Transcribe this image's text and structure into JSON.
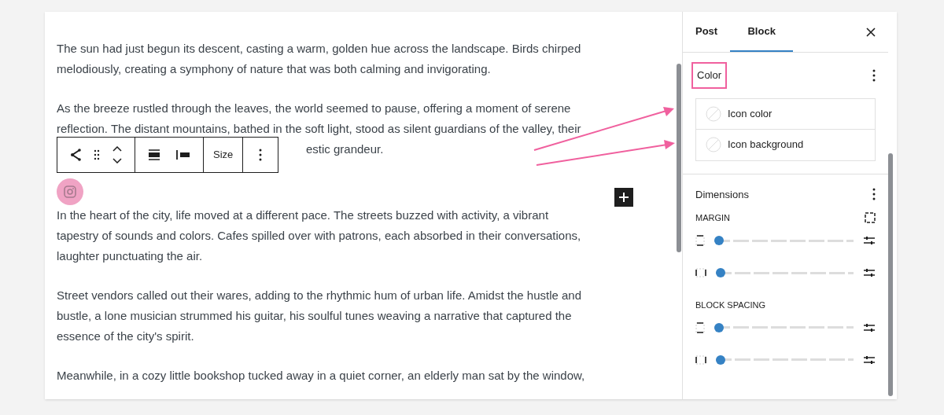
{
  "editor": {
    "paragraphs": [
      {
        "lines": [
          "The sun had just begun its descent, casting a warm, golden hue across the landscape. Birds chirped",
          "melodiously, creating a symphony of nature that was both calming and invigorating."
        ]
      },
      {
        "lines": [
          "As the breeze rustled through the leaves, the world seemed to pause, offering a moment of serene",
          "reflection. The distant mountains, bathed in the soft light, stood as silent guardians of the valley, their",
          "estic grandeur."
        ]
      },
      {
        "lines": [
          "In the heart of the city, life moved at a different pace. The streets buzzed with activity, a vibrant",
          "tapestry of sounds and colors. Cafes spilled over with patrons, each absorbed in their conversations,",
          "laughter punctuating the air."
        ]
      },
      {
        "lines": [
          "Street vendors called out their wares, adding to the rhythmic hum of urban life. Amidst the hustle and",
          "bustle, a lone musician strummed his guitar, his soulful tunes weaving a narrative that captured the",
          "essence of the city's spirit."
        ]
      },
      {
        "lines": [
          "Meanwhile, in a cozy little bookshop tucked away in a quiet corner, an elderly man sat by the window,"
        ]
      }
    ],
    "toolbar": {
      "size_button": "Size"
    }
  },
  "sidebar": {
    "tabs": [
      {
        "label": "Post",
        "selected": false
      },
      {
        "label": "Block",
        "selected": true
      }
    ],
    "color": {
      "title": "Color",
      "highlighted": true,
      "items": [
        {
          "label": "Icon color"
        },
        {
          "label": "Icon background"
        }
      ]
    },
    "dimensions": {
      "title": "Dimensions",
      "groups": [
        {
          "label": "MARGIN",
          "linked_toggle": true,
          "sliders": [
            {
              "kind": "vertical",
              "level": 0
            },
            {
              "kind": "horizontal",
              "level": 0
            }
          ]
        },
        {
          "label": "BLOCK SPACING",
          "sliders": [
            {
              "kind": "vertical",
              "level": 0
            },
            {
              "kind": "horizontal",
              "level": 0
            }
          ]
        }
      ]
    }
  }
}
